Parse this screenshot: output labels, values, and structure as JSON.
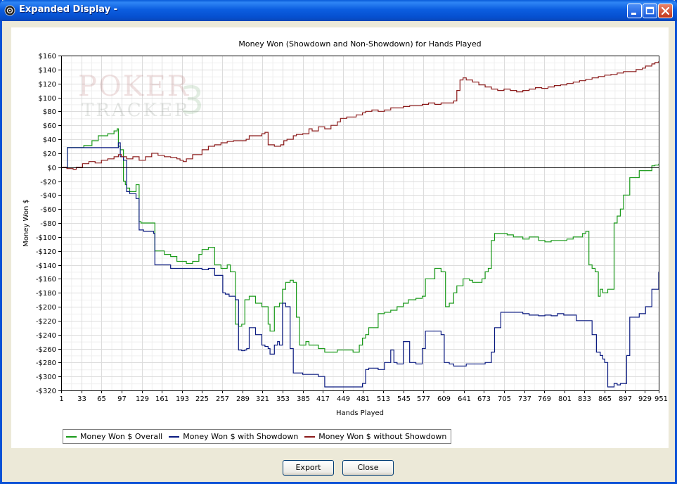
{
  "window": {
    "title": "Expanded Display -"
  },
  "buttons": {
    "export": "Export",
    "close": "Close"
  },
  "colors": {
    "overall": "#1a9a1a",
    "with_showdown": "#0a1a80",
    "without_showdown": "#8b1a1a",
    "titlebar": "#0a5bd9"
  },
  "chart_data": {
    "type": "line",
    "title": "Money Won (Showdown and Non-Showdown) for Hands Played",
    "xlabel": "Hands Played",
    "ylabel": "Money Won $",
    "xlim": [
      1,
      951
    ],
    "ylim": [
      -320,
      160
    ],
    "x_ticks": [
      1,
      33,
      65,
      97,
      129,
      161,
      193,
      225,
      257,
      289,
      321,
      353,
      385,
      417,
      449,
      481,
      513,
      545,
      577,
      609,
      641,
      673,
      705,
      737,
      769,
      801,
      833,
      865,
      897,
      929,
      951
    ],
    "y_ticks": [
      160,
      140,
      120,
      100,
      80,
      60,
      40,
      20,
      0,
      -20,
      -40,
      -60,
      -80,
      -100,
      -120,
      -140,
      -160,
      -180,
      -200,
      -220,
      -240,
      -260,
      -280,
      -300,
      -320
    ],
    "y_tick_labels": [
      "$160",
      "$140",
      "$120",
      "$100",
      "$80",
      "$60",
      "$40",
      "$20",
      "$0",
      "-$20",
      "-$40",
      "-$60",
      "-$80",
      "-$100",
      "-$120",
      "-$140",
      "-$160",
      "-$180",
      "-$200",
      "-$220",
      "-$240",
      "-$260",
      "-$280",
      "-$300",
      "-$320"
    ],
    "grid": true,
    "legend_position": "bottom-left",
    "series": [
      {
        "name": "Money Won $ Overall",
        "x": [
          1,
          10,
          11,
          22,
          37,
          50,
          60,
          75,
          85,
          90,
          92,
          95,
          100,
          103,
          105,
          110,
          120,
          125,
          128,
          132,
          148,
          150,
          165,
          175,
          185,
          200,
          210,
          220,
          225,
          235,
          245,
          255,
          260,
          265,
          270,
          278,
          283,
          288,
          293,
          300,
          310,
          320,
          330,
          333,
          340,
          348,
          353,
          358,
          365,
          370,
          375,
          380,
          385,
          390,
          395,
          410,
          420,
          425,
          440,
          455,
          465,
          475,
          480,
          485,
          490,
          505,
          515,
          525,
          535,
          545,
          553,
          565,
          575,
          580,
          595,
          605,
          610,
          612,
          618,
          625,
          630,
          640,
          650,
          655,
          660,
          670,
          675,
          680,
          685,
          690,
          700,
          710,
          720,
          735,
          745,
          760,
          770,
          780,
          790,
          805,
          815,
          830,
          835,
          840,
          845,
          850,
          855,
          858,
          862,
          865,
          870,
          880,
          885,
          890,
          895,
          905,
          920,
          930,
          940,
          945,
          951
        ],
        "y": [
          0,
          0,
          28,
          28,
          31,
          38,
          45,
          48,
          52,
          55,
          30,
          25,
          -20,
          -25,
          -30,
          -35,
          -25,
          -78,
          -80,
          -80,
          -80,
          -120,
          -125,
          -128,
          -135,
          -138,
          -135,
          -125,
          -118,
          -115,
          -140,
          -145,
          -145,
          -140,
          -150,
          -225,
          -228,
          -225,
          -190,
          -185,
          -195,
          -200,
          -225,
          -235,
          -200,
          -195,
          -175,
          -165,
          -162,
          -165,
          -215,
          -255,
          -255,
          -250,
          -255,
          -260,
          -265,
          -265,
          -262,
          -262,
          -265,
          -255,
          -245,
          -240,
          -230,
          -210,
          -208,
          -205,
          -200,
          -195,
          -190,
          -188,
          -185,
          -160,
          -145,
          -150,
          -150,
          -200,
          -195,
          -180,
          -170,
          -160,
          -162,
          -165,
          -165,
          -160,
          -150,
          -145,
          -105,
          -95,
          -95,
          -97,
          -100,
          -103,
          -100,
          -105,
          -107,
          -105,
          -105,
          -103,
          -100,
          -95,
          -92,
          -140,
          -145,
          -150,
          -185,
          -175,
          -180,
          -180,
          -175,
          -80,
          -70,
          -60,
          -40,
          -15,
          -5,
          -5,
          2,
          3,
          5
        ]
      },
      {
        "name": "Money Won $ with Showdown",
        "x": [
          1,
          10,
          11,
          65,
          92,
          95,
          100,
          105,
          110,
          120,
          125,
          132,
          148,
          150,
          175,
          210,
          225,
          235,
          245,
          258,
          262,
          268,
          278,
          283,
          288,
          293,
          296,
          300,
          310,
          320,
          325,
          330,
          333,
          340,
          345,
          348,
          353,
          358,
          360,
          365,
          370,
          385,
          410,
          420,
          440,
          470,
          480,
          485,
          490,
          505,
          515,
          525,
          530,
          535,
          545,
          555,
          565,
          575,
          580,
          595,
          605,
          610,
          618,
          625,
          630,
          645,
          670,
          675,
          685,
          690,
          700,
          710,
          735,
          745,
          760,
          770,
          780,
          790,
          800,
          820,
          830,
          840,
          845,
          852,
          858,
          862,
          865,
          870,
          880,
          885,
          890,
          900,
          905,
          920,
          930,
          940,
          951
        ],
        "y": [
          0,
          0,
          28,
          28,
          35,
          15,
          10,
          -35,
          -38,
          -45,
          -90,
          -92,
          -95,
          -140,
          -145,
          -145,
          -147,
          -145,
          -155,
          -180,
          -182,
          -185,
          -190,
          -262,
          -263,
          -262,
          -260,
          -230,
          -240,
          -255,
          -257,
          -260,
          -268,
          -255,
          -250,
          -255,
          -195,
          -200,
          -200,
          -260,
          -295,
          -297,
          -300,
          -315,
          -315,
          -315,
          -310,
          -290,
          -288,
          -290,
          -280,
          -262,
          -280,
          -282,
          -250,
          -280,
          -282,
          -260,
          -235,
          -235,
          -240,
          -280,
          -282,
          -285,
          -285,
          -282,
          -282,
          -280,
          -265,
          -230,
          -208,
          -208,
          -210,
          -212,
          -213,
          -212,
          -213,
          -210,
          -212,
          -220,
          -220,
          -220,
          -240,
          -265,
          -270,
          -275,
          -280,
          -315,
          -310,
          -312,
          -310,
          -270,
          -215,
          -210,
          -200,
          -175,
          -150
        ]
      },
      {
        "name": "Money Won $ without Showdown",
        "x": [
          1,
          10,
          20,
          25,
          35,
          45,
          55,
          65,
          75,
          85,
          92,
          97,
          105,
          115,
          125,
          135,
          145,
          155,
          165,
          175,
          185,
          190,
          195,
          200,
          210,
          225,
          235,
          245,
          255,
          265,
          275,
          285,
          295,
          300,
          310,
          320,
          325,
          330,
          340,
          350,
          355,
          360,
          370,
          375,
          385,
          395,
          400,
          410,
          420,
          430,
          440,
          445,
          455,
          470,
          480,
          485,
          495,
          505,
          515,
          525,
          530,
          545,
          555,
          565,
          575,
          585,
          595,
          605,
          615,
          625,
          630,
          635,
          640,
          645,
          655,
          665,
          675,
          685,
          695,
          705,
          715,
          725,
          735,
          745,
          755,
          765,
          775,
          785,
          795,
          805,
          815,
          825,
          835,
          845,
          855,
          865,
          875,
          885,
          895,
          905,
          915,
          925,
          930,
          940,
          945,
          951
        ],
        "y": [
          0,
          -2,
          -3,
          0,
          5,
          8,
          6,
          10,
          12,
          15,
          18,
          15,
          12,
          15,
          10,
          15,
          20,
          17,
          15,
          14,
          12,
          10,
          8,
          12,
          18,
          25,
          30,
          32,
          35,
          37,
          38,
          38,
          40,
          45,
          45,
          48,
          50,
          32,
          30,
          32,
          38,
          40,
          45,
          47,
          48,
          55,
          52,
          58,
          55,
          60,
          65,
          70,
          72,
          75,
          78,
          80,
          82,
          80,
          82,
          85,
          85,
          87,
          88,
          88,
          90,
          92,
          90,
          92,
          92,
          95,
          110,
          125,
          128,
          125,
          122,
          118,
          115,
          112,
          110,
          112,
          110,
          108,
          110,
          112,
          114,
          113,
          115,
          117,
          118,
          120,
          122,
          124,
          126,
          128,
          130,
          132,
          133,
          135,
          137,
          137,
          140,
          142,
          145,
          148,
          150,
          152
        ]
      }
    ]
  }
}
